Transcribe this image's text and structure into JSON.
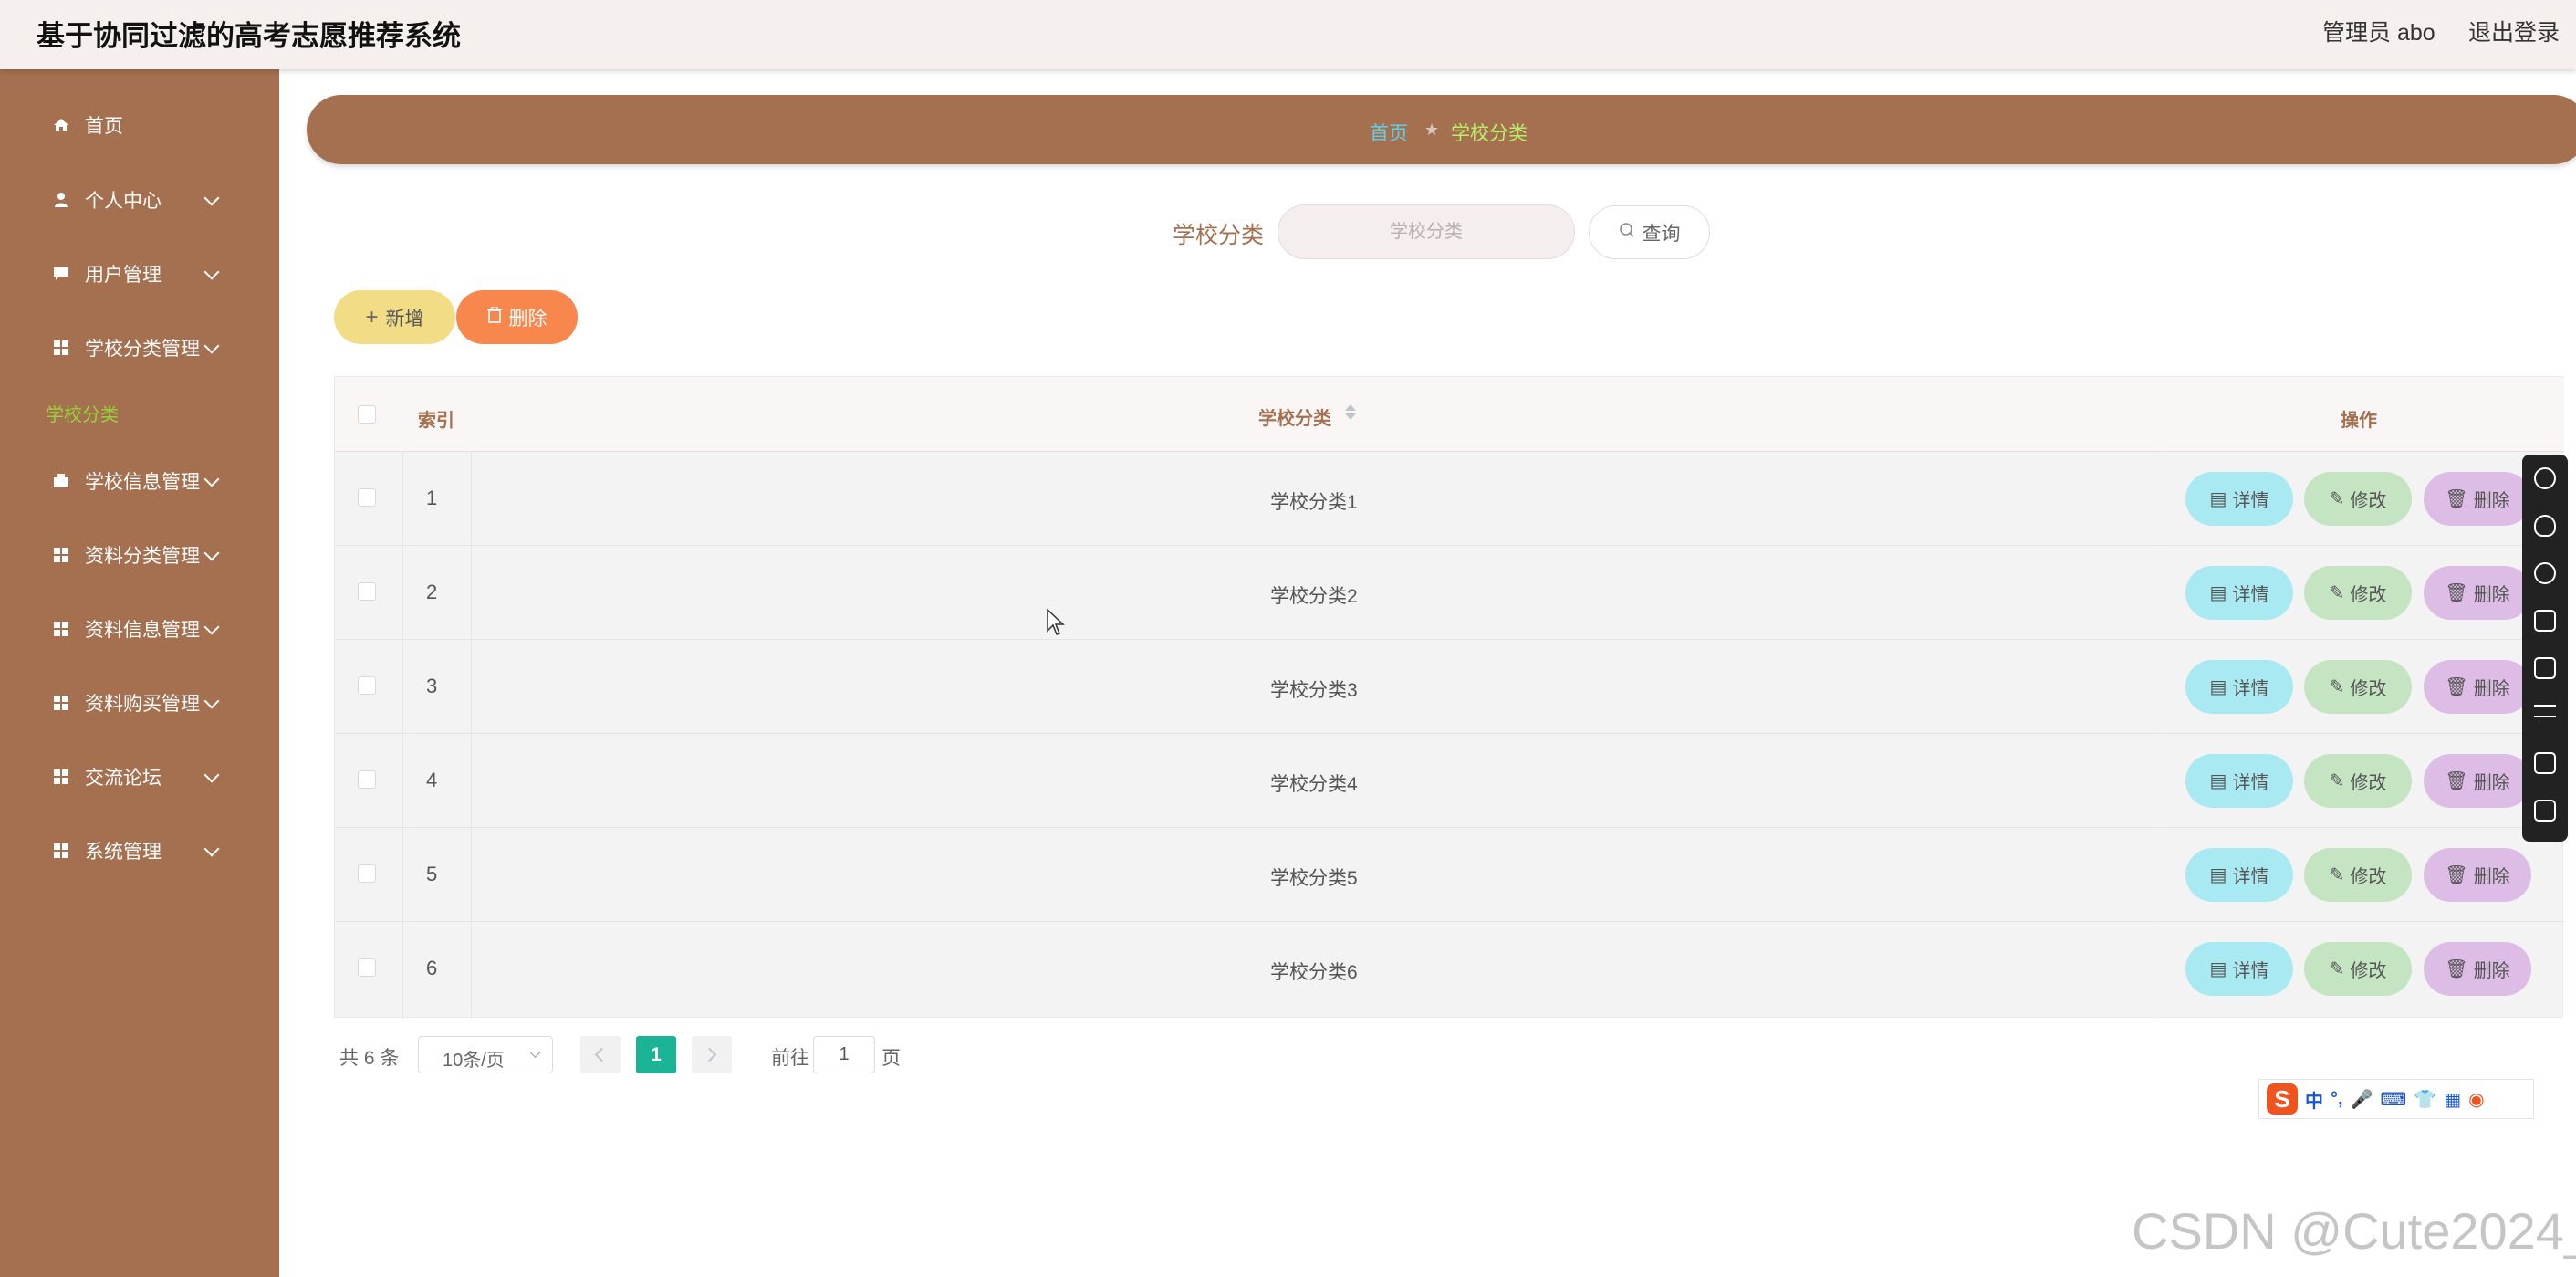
{
  "app": {
    "title": "基于协同过滤的高考志愿推荐系统",
    "admin": "管理员 abo",
    "logout": "退出登录"
  },
  "colors": {
    "sidebar": "#a47050",
    "header": "#f5efee",
    "accent_current_page": "#1ab394",
    "add_button": "#f2dc86",
    "delete_button": "#f7874c",
    "detail_button": "#a9e9f1",
    "edit_button": "#c4e4c2",
    "row_delete_button": "#ddbde6"
  },
  "sidebar": {
    "items": [
      {
        "label": "首页",
        "icon": "home-icon"
      },
      {
        "label": "个人中心",
        "icon": "user-icon"
      },
      {
        "label": "用户管理",
        "icon": "chat-icon"
      },
      {
        "label": "学校分类管理",
        "icon": "grid-icon"
      },
      {
        "label": "学校信息管理",
        "icon": "briefcase-icon"
      },
      {
        "label": "资料分类管理",
        "icon": "grid-icon"
      },
      {
        "label": "资料信息管理",
        "icon": "grid-icon"
      },
      {
        "label": "资料购买管理",
        "icon": "grid-icon"
      },
      {
        "label": "交流论坛",
        "icon": "grid-icon"
      },
      {
        "label": "系统管理",
        "icon": "grid-icon"
      }
    ],
    "active_subitem": "学校分类"
  },
  "breadcrumb": {
    "home": "首页",
    "separator": "★",
    "current": "学校分类"
  },
  "search": {
    "label": "学校分类",
    "placeholder": "学校分类",
    "button": "查询"
  },
  "actions": {
    "add": "新增",
    "delete": "删除"
  },
  "table": {
    "headers": {
      "index": "索引",
      "name": "学校分类",
      "ops": "操作"
    },
    "op_labels": {
      "detail": "详情",
      "edit": "修改",
      "delete": "删除"
    },
    "rows": [
      {
        "index": "1",
        "name": "学校分类1"
      },
      {
        "index": "2",
        "name": "学校分类2"
      },
      {
        "index": "3",
        "name": "学校分类3"
      },
      {
        "index": "4",
        "name": "学校分类4"
      },
      {
        "index": "5",
        "name": "学校分类5"
      },
      {
        "index": "6",
        "name": "学校分类6"
      }
    ]
  },
  "pagination": {
    "total": "共 6 条",
    "page_size": "10条/页",
    "current": "1",
    "goto_label": "前往",
    "goto_value": "1",
    "unit": "页"
  },
  "ime": {
    "logo": "S",
    "mode": "中",
    "punct": "°,"
  },
  "watermark": "CSDN @Cute2024_"
}
